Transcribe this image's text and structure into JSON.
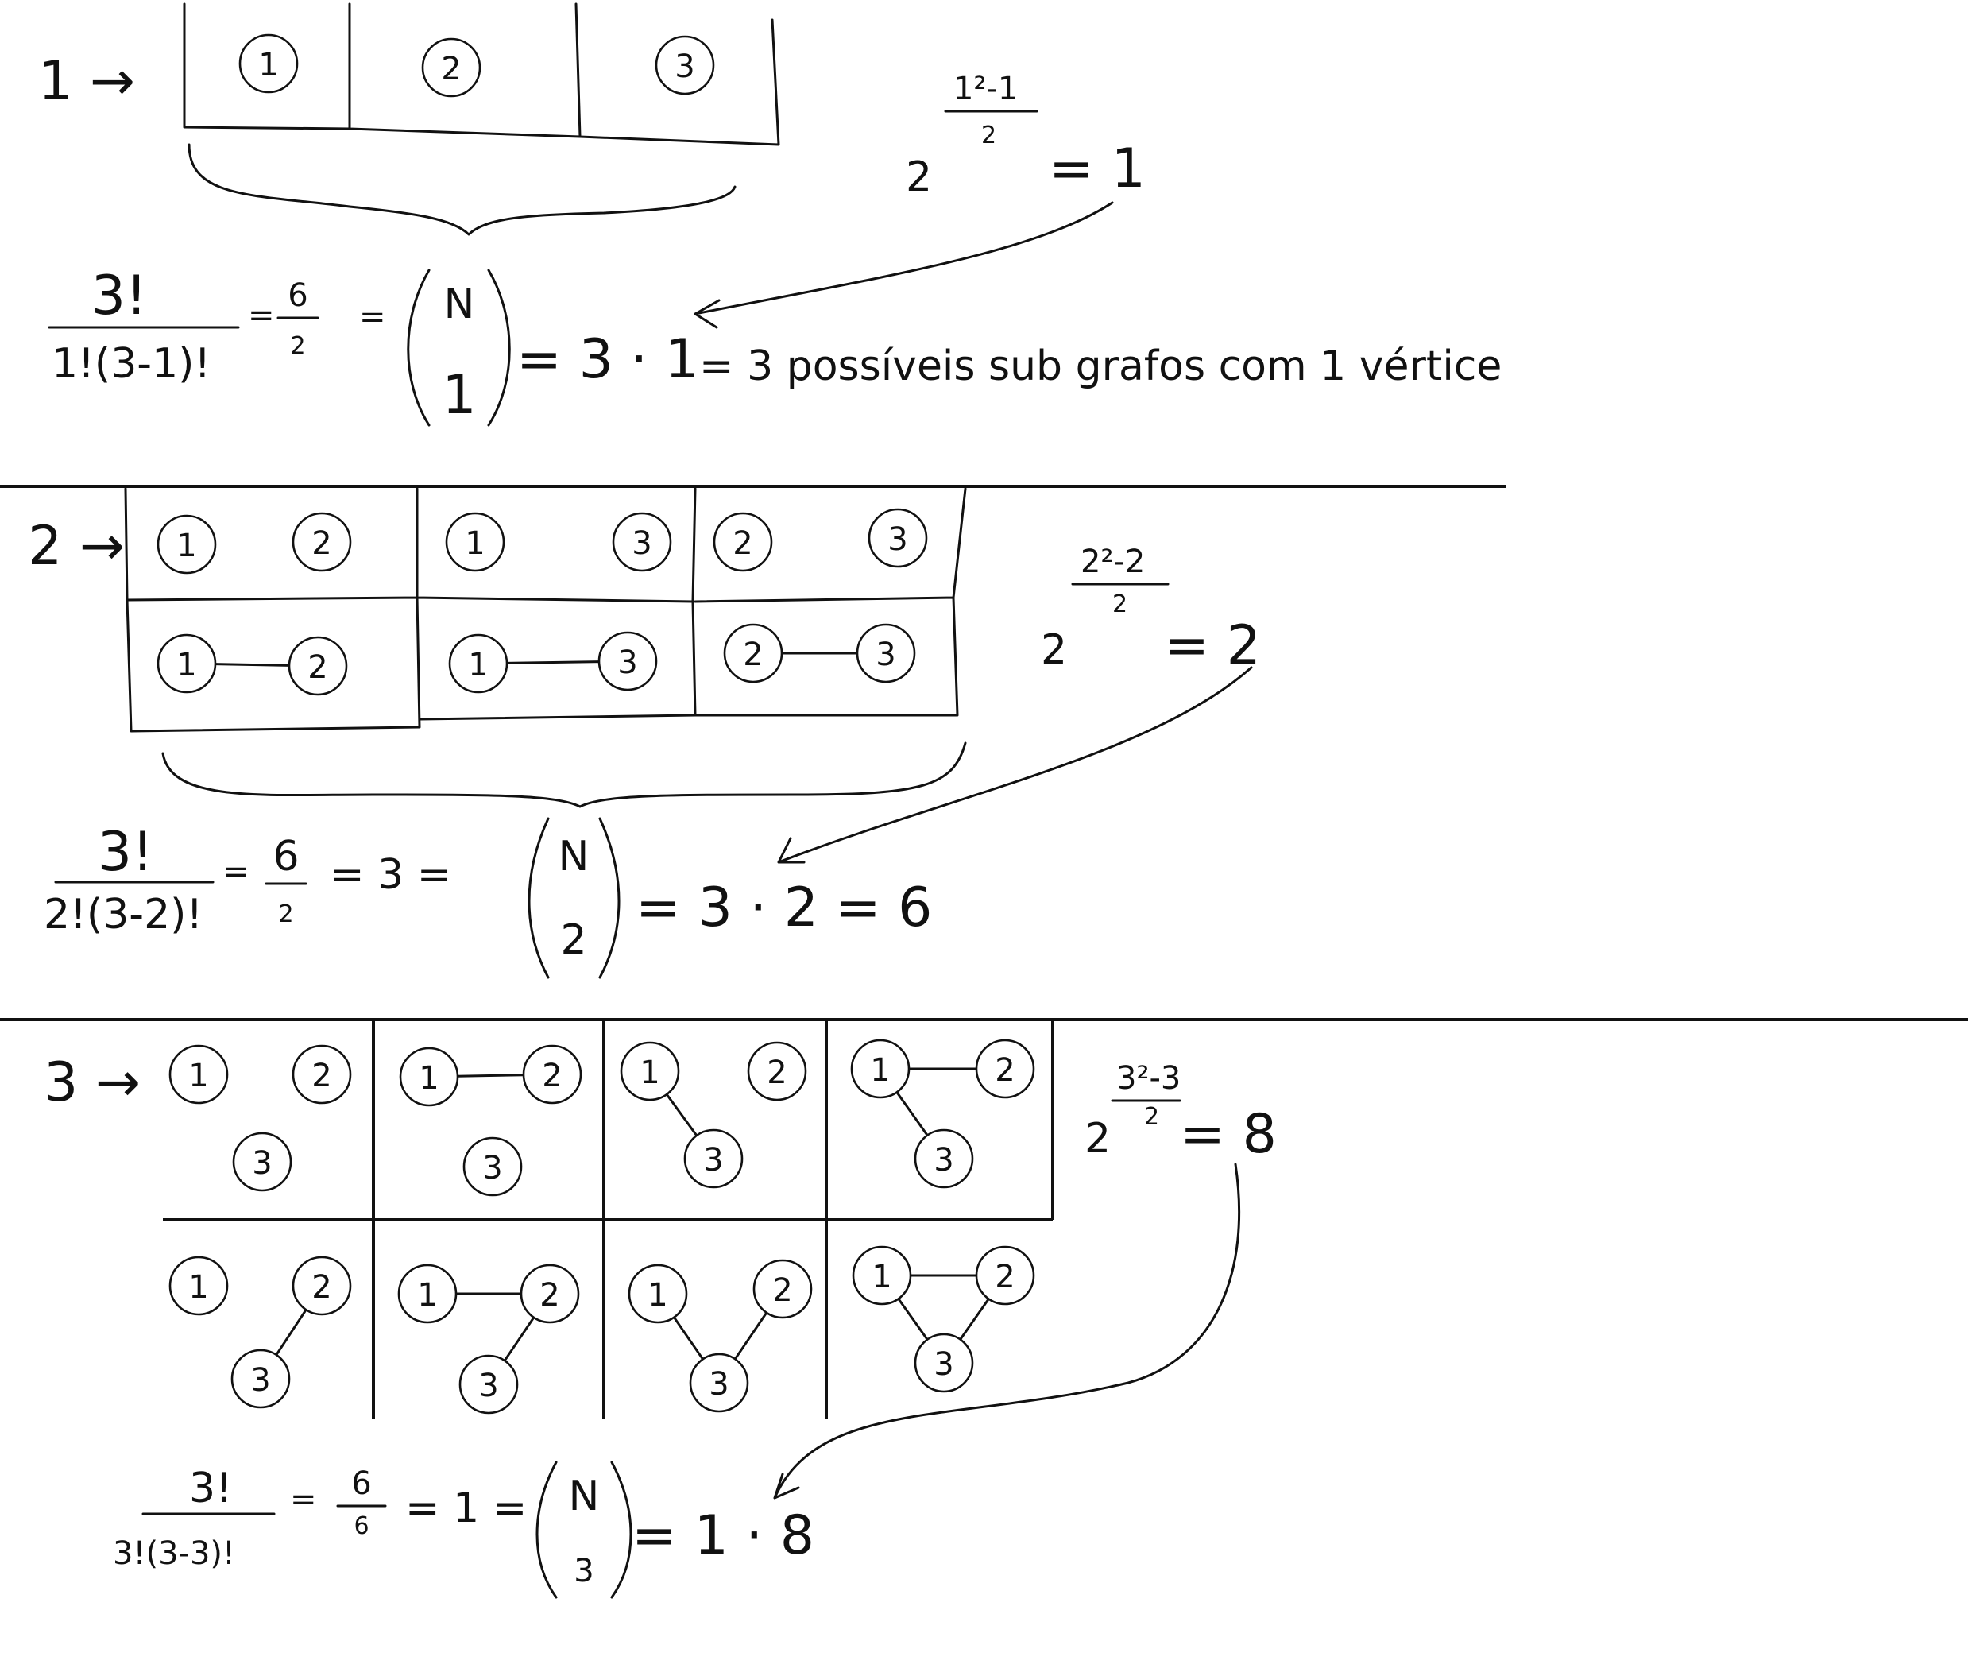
{
  "sections": [
    {
      "label": "1 →",
      "frac_num": "3!",
      "frac_den": "1!(3-1)!",
      "eq1": "=",
      "frac2_num": "6",
      "frac2_den": "2",
      "eq2": "=",
      "binom_top": "N",
      "binom_bottom": "1",
      "result": "= 3 · 1",
      "result_tail": "= 3 possíveis sub grafos com 1 vértice",
      "power_base": "2",
      "power_exp_num": "1²-1",
      "power_exp_den": "2",
      "power_result": "= 1",
      "graphs": [
        {
          "nodes": [
            "1"
          ],
          "edges": []
        },
        {
          "nodes": [
            "2"
          ],
          "edges": []
        },
        {
          "nodes": [
            "3"
          ],
          "edges": []
        }
      ]
    },
    {
      "label": "2 →",
      "frac_num": "3!",
      "frac_den": "2!(3-2)!",
      "eq1": "=",
      "frac2_num": "6",
      "frac2_den": "2",
      "mid": "= 3 =",
      "binom_top": "N",
      "binom_bottom": "2",
      "result": "= 3 · 2 = 6",
      "power_base": "2",
      "power_exp_num": "2²-2",
      "power_exp_den": "2",
      "power_result": "= 2",
      "graphs": [
        {
          "nodes": [
            "1",
            "2"
          ],
          "edges": []
        },
        {
          "nodes": [
            "1",
            "3"
          ],
          "edges": []
        },
        {
          "nodes": [
            "2",
            "3"
          ],
          "edges": []
        },
        {
          "nodes": [
            "1",
            "2"
          ],
          "edges": [
            [
              "1",
              "2"
            ]
          ]
        },
        {
          "nodes": [
            "1",
            "3"
          ],
          "edges": [
            [
              "1",
              "3"
            ]
          ]
        },
        {
          "nodes": [
            "2",
            "3"
          ],
          "edges": [
            [
              "2",
              "3"
            ]
          ]
        }
      ]
    },
    {
      "label": "3 →",
      "frac_num": "3!",
      "frac_den": "3!(3-3)!",
      "eq1": "=",
      "frac2_num": "6",
      "frac2_den": "6",
      "mid": "= 1 =",
      "binom_top": "N",
      "binom_bottom": "3",
      "result": "= 1 · 8",
      "power_base": "2",
      "power_exp_num": "3²-3",
      "power_exp_den": "2",
      "power_result": "= 8",
      "graphs": [
        {
          "nodes": [
            "1",
            "2",
            "3"
          ],
          "edges": []
        },
        {
          "nodes": [
            "1",
            "2",
            "3"
          ],
          "edges": [
            [
              "1",
              "2"
            ]
          ]
        },
        {
          "nodes": [
            "1",
            "2",
            "3"
          ],
          "edges": [
            [
              "1",
              "3"
            ]
          ]
        },
        {
          "nodes": [
            "1",
            "2",
            "3"
          ],
          "edges": [
            [
              "1",
              "2"
            ],
            [
              "1",
              "3"
            ]
          ]
        },
        {
          "nodes": [
            "1",
            "2",
            "3"
          ],
          "edges": [
            [
              "2",
              "3"
            ]
          ]
        },
        {
          "nodes": [
            "1",
            "2",
            "3"
          ],
          "edges": [
            [
              "1",
              "2"
            ],
            [
              "2",
              "3"
            ]
          ]
        },
        {
          "nodes": [
            "1",
            "2",
            "3"
          ],
          "edges": [
            [
              "1",
              "3"
            ],
            [
              "2",
              "3"
            ]
          ]
        },
        {
          "nodes": [
            "1",
            "2",
            "3"
          ],
          "edges": [
            [
              "1",
              "2"
            ],
            [
              "1",
              "3"
            ],
            [
              "2",
              "3"
            ]
          ]
        }
      ]
    }
  ]
}
